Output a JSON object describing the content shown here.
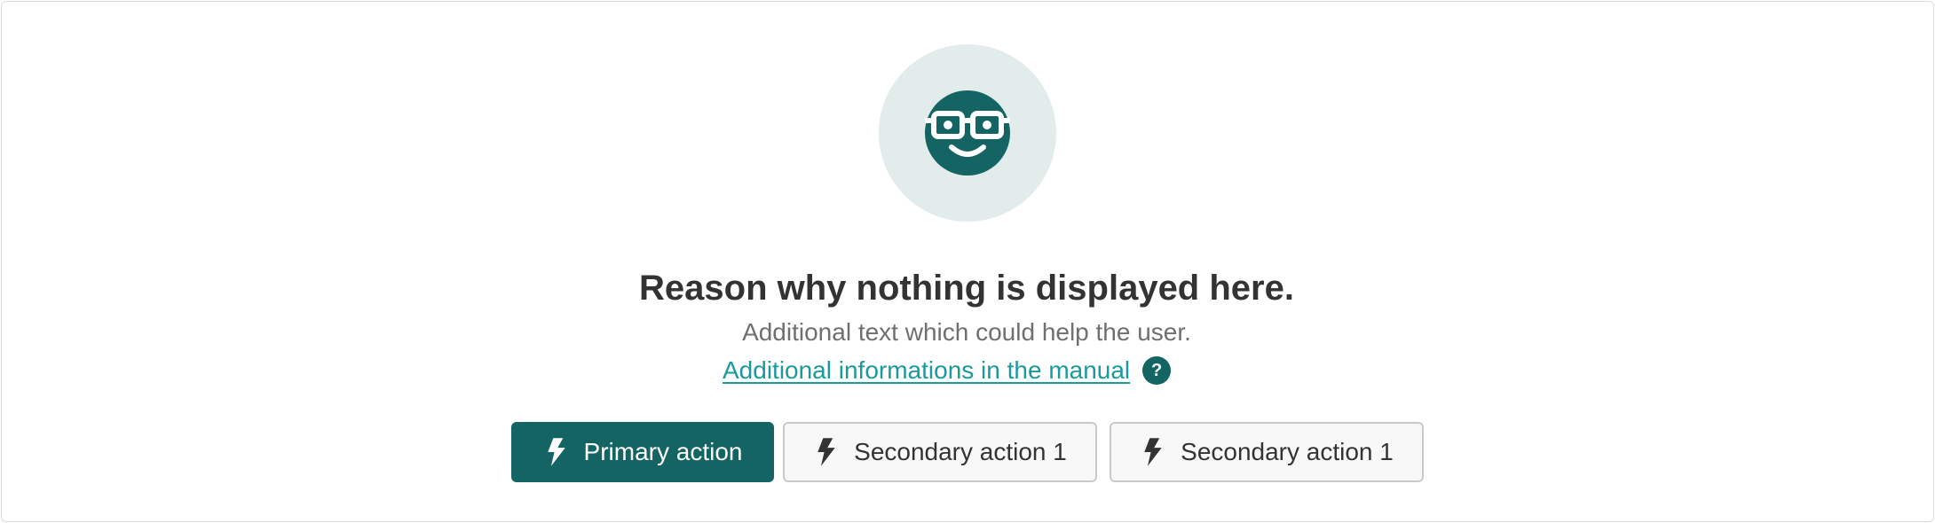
{
  "empty_state": {
    "icon": "nerd-face-icon",
    "title": "Reason why nothing is displayed here.",
    "subtitle": "Additional text which could help the user.",
    "help_link": "Additional informations in the manual",
    "help_badge": "?"
  },
  "actions": {
    "primary": {
      "label": "Primary action",
      "icon": "bolt-icon"
    },
    "secondary_1": {
      "label": "Secondary action 1",
      "icon": "bolt-icon"
    },
    "secondary_2": {
      "label": "Secondary action 1",
      "icon": "bolt-icon"
    }
  },
  "colors": {
    "accent": "#146464",
    "link": "#1a9a9a",
    "illustration_bg": "#e2eceb",
    "title": "#333333",
    "subtitle": "#6f6f6f"
  }
}
